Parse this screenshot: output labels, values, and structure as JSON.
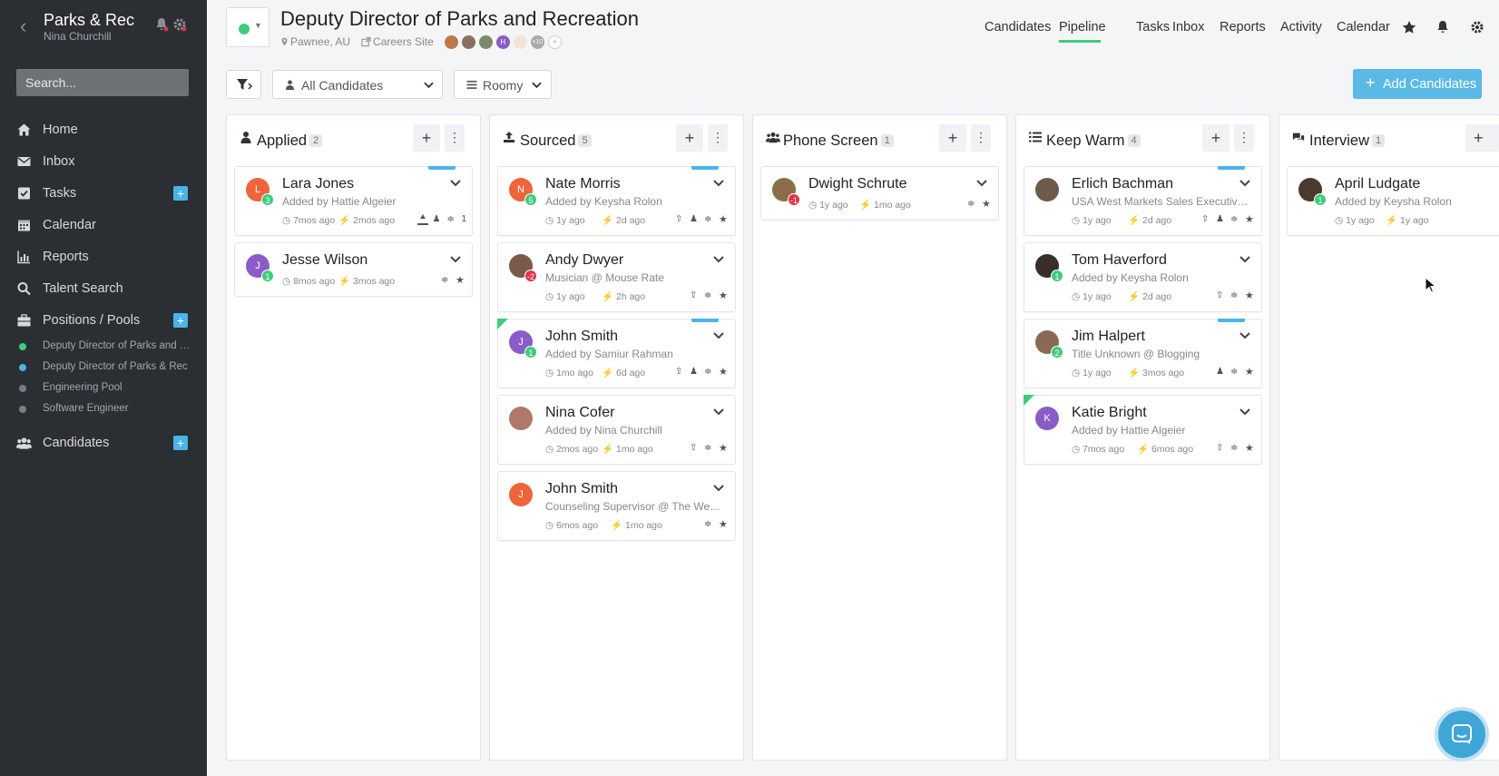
{
  "sidebar": {
    "org_name": "Parks & Rec",
    "user_name": "Nina Churchill",
    "search_placeholder": "Search...",
    "nav": [
      {
        "label": "Home",
        "icon": "home-icon"
      },
      {
        "label": "Inbox",
        "icon": "envelope-icon"
      },
      {
        "label": "Tasks",
        "icon": "checkbox-icon",
        "add": true
      },
      {
        "label": "Calendar",
        "icon": "calendar-icon"
      },
      {
        "label": "Reports",
        "icon": "bar-chart-icon"
      },
      {
        "label": "Talent Search",
        "icon": "search-icon"
      },
      {
        "label": "Positions / Pools",
        "icon": "briefcase-icon",
        "add": true
      },
      {
        "label": "Candidates",
        "icon": "users-icon",
        "add": true
      }
    ],
    "positions": [
      {
        "label": "Deputy Director of Parks and Recreation",
        "color": "#3fcc7a"
      },
      {
        "label": "Deputy Director of Parks & Rec",
        "color": "#49b4e8"
      },
      {
        "label": "Engineering Pool",
        "color": "#7a7e84"
      },
      {
        "label": "Software Engineer",
        "color": "#7a7e84"
      }
    ]
  },
  "header": {
    "title": "Deputy Director of Parks and Recreation",
    "location": "Pawnee, AU",
    "careers_site": "Careers Site",
    "team_more": "+10",
    "nav": [
      "Candidates",
      "Pipeline",
      "Tasks",
      "Inbox",
      "Reports",
      "Activity",
      "Calendar"
    ],
    "active_nav": "Pipeline"
  },
  "toolbar": {
    "candidate_filter": "All Candidates",
    "view_mode": "Roomy",
    "add_label": "Add Candidates"
  },
  "columns": [
    {
      "title": "Applied",
      "count": "2",
      "cards": [
        {
          "name": "Lara Jones",
          "sub": "Added by Hattie Algeier",
          "t1": "7mos ago",
          "t2": "2mos ago",
          "initial": "L",
          "color": "#f0643a",
          "badge": "3",
          "badge_color": "#3fcc7a",
          "tag": true,
          "extra": "1"
        },
        {
          "name": "Jesse Wilson",
          "sub": "",
          "t1": "8mos ago",
          "t2": "3mos ago",
          "initial": "J",
          "color": "#8a5cc8",
          "badge": "1",
          "badge_color": "#3fcc7a"
        }
      ]
    },
    {
      "title": "Sourced",
      "count": "5",
      "cards": [
        {
          "name": "Nate Morris",
          "sub": "Added by Keysha Rolon",
          "t1": "1y ago",
          "t2": "2d ago",
          "initial": "N",
          "color": "#f0643a",
          "badge": "5",
          "badge_color": "#3fcc7a",
          "tag": true
        },
        {
          "name": "Andy Dwyer",
          "sub": "Musician @ Mouse Rate",
          "t1": "1y ago",
          "t2": "2h ago",
          "initial": "",
          "color": "#7a5a48",
          "badge": "-2",
          "badge_color": "#e0334a"
        },
        {
          "name": "John Smith",
          "sub": "Added by Samiur Rahman",
          "t1": "1mo ago",
          "t2": "6d ago",
          "initial": "J",
          "color": "#8a5cc8",
          "badge": "1",
          "badge_color": "#3fcc7a",
          "tag": true,
          "corner": true
        },
        {
          "name": "Nina Cofer",
          "sub": "Added by Nina Churchill",
          "t1": "2mos ago",
          "t2": "1mo ago",
          "initial": "",
          "color": "#b07868"
        },
        {
          "name": "John Smith",
          "sub": "Counseling Supervisor @ The Wesleyan",
          "t1": "6mos ago",
          "t2": "1mo ago",
          "initial": "J",
          "color": "#f0643a"
        }
      ]
    },
    {
      "title": "Phone Screen",
      "count": "1",
      "cards": [
        {
          "name": "Dwight Schrute",
          "sub": "",
          "t1": "1y ago",
          "t2": "1mo ago",
          "initial": "",
          "color": "#8b6d4a",
          "badge": "-1",
          "badge_color": "#e0334a"
        }
      ]
    },
    {
      "title": "Keep Warm",
      "count": "4",
      "cards": [
        {
          "name": "Erlich Bachman",
          "sub": "USA West Markets Sales Executive @ Aviato",
          "t1": "1y ago",
          "t2": "2d ago",
          "initial": "",
          "color": "#6d5a48",
          "tag": true
        },
        {
          "name": "Tom Haverford",
          "sub": "Added by Keysha Rolon",
          "t1": "1y ago",
          "t2": "2d ago",
          "initial": "",
          "color": "#3a2e28",
          "badge": "1",
          "badge_color": "#3fcc7a"
        },
        {
          "name": "Jim Halpert",
          "sub": "Title Unknown @ Blogging",
          "t1": "1y ago",
          "t2": "3mos ago",
          "initial": "",
          "color": "#8a6a55",
          "badge": "2",
          "badge_color": "#3fcc7a",
          "tag": true
        },
        {
          "name": "Katie Bright",
          "sub": "Added by Hattie Algeier",
          "t1": "7mos ago",
          "t2": "6mos ago",
          "initial": "K",
          "color": "#8a5cc8",
          "corner": true
        }
      ]
    },
    {
      "title": "Interview",
      "count": "1",
      "cards": [
        {
          "name": "April Ludgate",
          "sub": "Added by Keysha Rolon",
          "t1": "1y ago",
          "t2": "1y ago",
          "initial": "",
          "color": "#4a3a30",
          "badge": "1",
          "badge_color": "#3fcc7a"
        }
      ]
    }
  ]
}
